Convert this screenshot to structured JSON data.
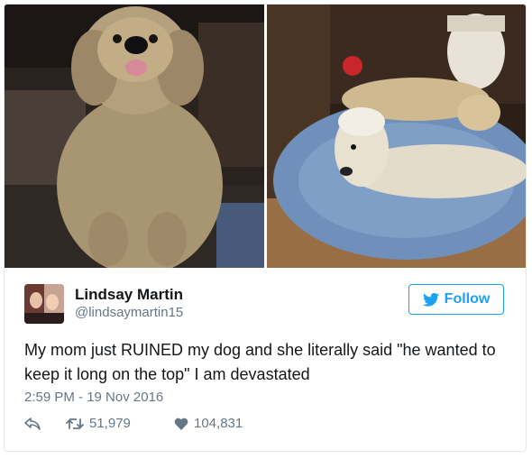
{
  "tweet": {
    "author_name": "Lindsay Martin",
    "author_handle": "@lindsaymartin15",
    "follow_label": "Follow",
    "text": "My mom just RUINED my dog and she literally said \"he wanted to keep it long on the top\" I am devastated",
    "timestamp": "2:59 PM - 19 Nov 2016",
    "retweets": "51,979",
    "likes": "104,831"
  },
  "icons": {
    "follow": "twitter-bird-icon",
    "reply": "reply-icon",
    "retweet": "retweet-icon",
    "like": "heart-icon"
  },
  "colors": {
    "accent": "#1da1f2",
    "secondary_text": "#657786",
    "primary_text": "#14171a"
  }
}
